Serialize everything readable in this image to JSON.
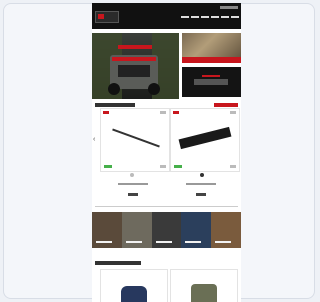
{
  "colors": {
    "brand_red": "#c8161d",
    "header_bg": "#111111",
    "in_stock_green": "#46b04a"
  },
  "icons": [
    "store-logo",
    "chevron-left-icon",
    "chevron-right-icon",
    "heart-icon"
  ],
  "carousel": {
    "active_dot": 1,
    "dots": 2
  },
  "products_top": [
    {},
    {}
  ],
  "categories": [
    {},
    {},
    {},
    {},
    {}
  ],
  "products_bottom": [
    {},
    {}
  ]
}
